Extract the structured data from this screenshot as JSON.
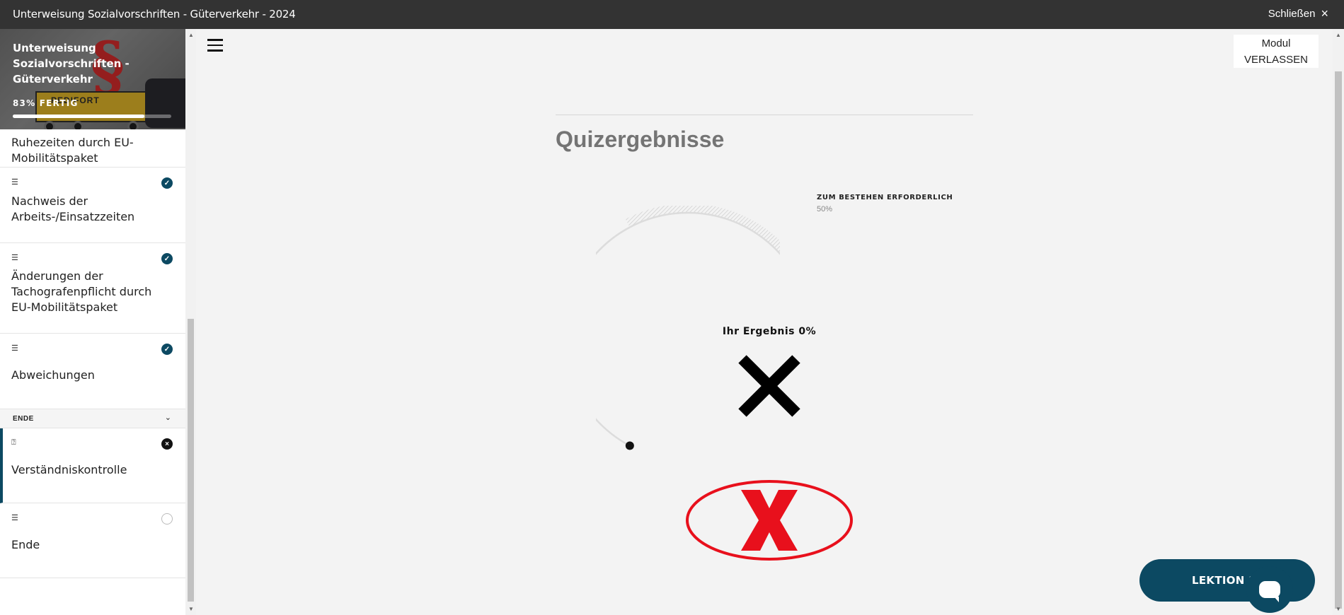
{
  "topbar": {
    "title": "Unterweisung Sozialvorschriften - Güterverkehr - 2024",
    "close_label": "Schließen",
    "close_icon": "×"
  },
  "sidebar": {
    "course_title": "Unterweisung Sozialvorschriften - Güterverkehr",
    "progress_text": "83% FERTIG",
    "progress_value": 0.83,
    "hero_logo_text": "PEDIFORT",
    "lessons": [
      {
        "label": "Ruhezeiten durch EU-Mobilitätspaket",
        "type_icon": "text-lines-icon",
        "status": "done"
      },
      {
        "label": "Nachweis der Arbeits-/Einsatzzeiten",
        "type_icon": "text-lines-icon",
        "status": "done"
      },
      {
        "label": "Änderungen der Tachografenpflicht durch EU-Mobilitätspaket",
        "type_icon": "text-lines-icon",
        "status": "done"
      },
      {
        "label": "Abweichungen",
        "type_icon": "text-lines-icon",
        "status": "done"
      }
    ],
    "section_title": "ENDE",
    "section_lessons": [
      {
        "label": "Verständniskontrolle",
        "type_icon": "quiz-icon",
        "status": "fail"
      },
      {
        "label": "Ende",
        "type_icon": "text-lines-icon",
        "status": "empty"
      }
    ]
  },
  "main": {
    "exit_line1": "Modul",
    "exit_line2": "VERLASSEN",
    "quiz_title": "Quizergebnisse",
    "required_label": "ZUM BESTEHEN ERFORDERLICH",
    "required_value": "50%",
    "required_fraction": 0.5,
    "result_label": "Ihr Ergebnis 0%",
    "result_fraction": 0.0,
    "next_button": "LEKTION 1",
    "colors": {
      "brand": "#0c4962",
      "fail_mark": "#e8101c"
    }
  }
}
